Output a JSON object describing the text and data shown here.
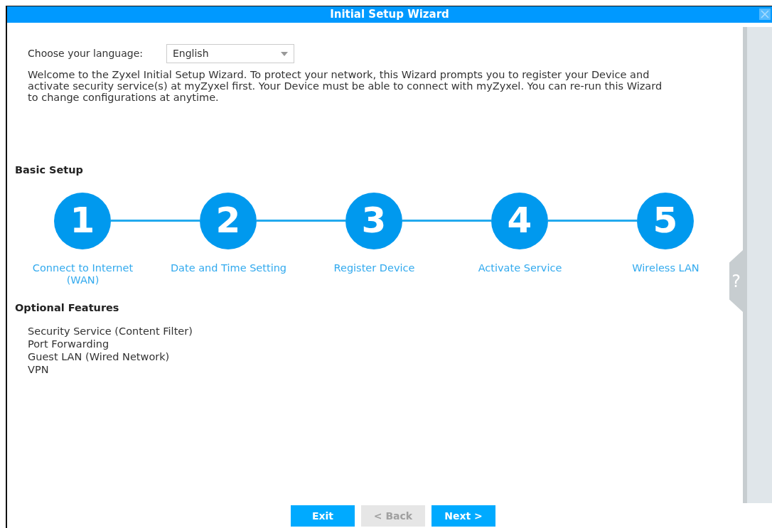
{
  "window": {
    "title": "Initial Setup Wizard"
  },
  "language": {
    "label": "Choose your language:",
    "value": "English"
  },
  "intro": "Welcome to the Zyxel Initial Setup Wizard. To protect your network, this Wizard prompts you to register your Device and activate security service(s) at myZyxel first. Your Device must be able to connect with myZyxel. You can re-run this Wizard to change configurations at anytime.",
  "basic_setup": {
    "title": "Basic Setup",
    "steps": [
      {
        "number": "1",
        "label": "Connect to Internet (WAN)"
      },
      {
        "number": "2",
        "label": "Date and Time Setting"
      },
      {
        "number": "3",
        "label": "Register Device"
      },
      {
        "number": "4",
        "label": "Activate Service"
      },
      {
        "number": "5",
        "label": "Wireless LAN"
      }
    ]
  },
  "optional_features": {
    "title": "Optional Features",
    "items": [
      "Security Service (Content Filter)",
      "Port Forwarding",
      "Guest LAN (Wired Network)",
      "VPN"
    ]
  },
  "help": {
    "label": "?"
  },
  "buttons": [
    {
      "label": "Exit",
      "disabled": false
    },
    {
      "label": "< Back",
      "disabled": true
    },
    {
      "label": "Next >",
      "disabled": false
    }
  ]
}
